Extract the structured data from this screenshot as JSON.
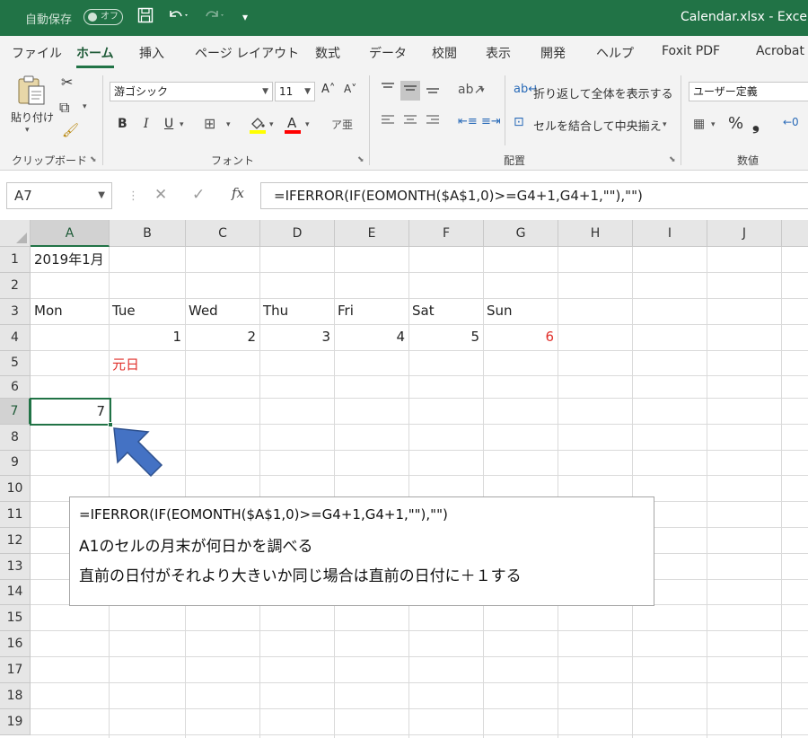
{
  "titlebar": {
    "autosave_label": "自動保存",
    "autosave_state": "オフ",
    "filename": "Calendar.xlsx  -  Excel"
  },
  "tabs": [
    "ファイル",
    "ホーム",
    "挿入",
    "ページ レイアウト",
    "数式",
    "データ",
    "校閲",
    "表示",
    "開発",
    "ヘルプ",
    "Foxit PDF",
    "Acrobat"
  ],
  "active_tab": "ホーム",
  "ribbon": {
    "clipboard": {
      "paste_label": "貼り付け",
      "group_label": "クリップボード"
    },
    "font": {
      "font_name": "游ゴシック",
      "font_size": "11",
      "group_label": "フォント"
    },
    "alignment": {
      "wrap_text": "折り返して全体を表示する",
      "merge_center": "セルを結合して中央揃え",
      "group_label": "配置"
    },
    "number": {
      "format": "ユーザー定義",
      "group_label": "数値"
    }
  },
  "formula_bar": {
    "name_box": "A7",
    "fx_label": "fx",
    "formula": "=IFERROR(IF(EOMONTH($A$1,0)>=G4+1,G4+1,\"\"),\"\")"
  },
  "sheet": {
    "columns": [
      "A",
      "B",
      "C",
      "D",
      "E",
      "F",
      "G",
      "H",
      "I",
      "J"
    ],
    "rows": [
      "1",
      "2",
      "3",
      "4",
      "5",
      "6",
      "7",
      "8",
      "9",
      "10",
      "11",
      "12",
      "13",
      "14",
      "15",
      "16",
      "17",
      "18",
      "19"
    ],
    "a1_title": "2019年1月",
    "weekdays": [
      "Mon",
      "Tue",
      "Wed",
      "Thu",
      "Fri",
      "Sat",
      "Sun"
    ],
    "row4_days": [
      "",
      "1",
      "2",
      "3",
      "4",
      "5",
      "6"
    ],
    "holiday_label": "元日",
    "a7_value": "7",
    "selected_cell": "A7"
  },
  "callout": {
    "line1": "=IFERROR(IF(EOMONTH($A$1,0)>=G4+1,G4+1,\"\"),\"\")",
    "line2": "A1のセルの月末が何日かを調べる",
    "line3": "直前の日付がそれより大きいか同じ場合は直前の日付に＋１する"
  },
  "colors": {
    "excel_green": "#217346",
    "holiday_red": "#e0302b",
    "arrow_blue": "#4472c4"
  }
}
